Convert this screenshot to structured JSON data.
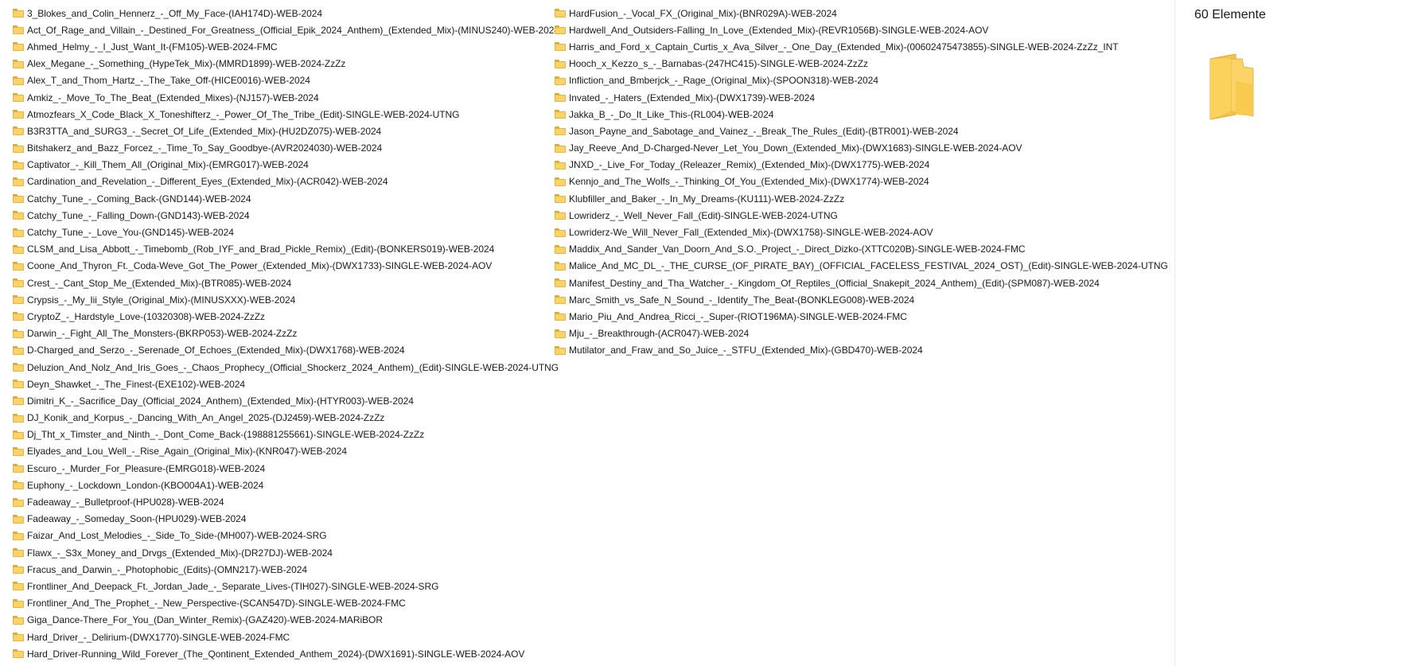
{
  "file_list": {
    "column_1": [
      "3_Blokes_and_Colin_Hennerz_-_Off_My_Face-(IAH174D)-WEB-2024",
      "Act_Of_Rage_and_Villain_-_Destined_For_Greatness_(Official_Epik_2024_Anthem)_(Extended_Mix)-(MINUS240)-WEB-2024",
      "Ahmed_Helmy_-_I_Just_Want_It-(FM105)-WEB-2024-FMC",
      "Alex_Megane_-_Something_(HypeTek_Mix)-(MMRD1899)-WEB-2024-ZzZz",
      "Alex_T_and_Thom_Hartz_-_The_Take_Off-(HICE0016)-WEB-2024",
      "Amkiz_-_Move_To_The_Beat_(Extended_Mixes)-(NJ157)-WEB-2024",
      "Atmozfears_X_Code_Black_X_Toneshifterz_-_Power_Of_The_Tribe_(Edit)-SINGLE-WEB-2024-UTNG",
      "B3R3TTA_and_SURG3_-_Secret_Of_Life_(Extended_Mix)-(HU2DZ075)-WEB-2024",
      "Bitshakerz_and_Bazz_Forcez_-_Time_To_Say_Goodbye-(AVR2024030)-WEB-2024",
      "Captivator_-_Kill_Them_All_(Original_Mix)-(EMRG017)-WEB-2024",
      "Cardination_and_Revelation_-_Different_Eyes_(Extended_Mix)-(ACR042)-WEB-2024",
      "Catchy_Tune_-_Coming_Back-(GND144)-WEB-2024",
      "Catchy_Tune_-_Falling_Down-(GND143)-WEB-2024",
      "Catchy_Tune_-_Love_You-(GND145)-WEB-2024",
      "CLSM_and_Lisa_Abbott_-_Timebomb_(Rob_IYF_and_Brad_Pickle_Remix)_(Edit)-(BONKERS019)-WEB-2024",
      "Coone_And_Thyron_Ft._Coda-Weve_Got_The_Power_(Extended_Mix)-(DWX1733)-SINGLE-WEB-2024-AOV",
      "Crest_-_Cant_Stop_Me_(Extended_Mix)-(BTR085)-WEB-2024",
      "Crypsis_-_My_Iii_Style_(Original_Mix)-(MINUSXXX)-WEB-2024",
      "CryptoZ_-_Hardstyle_Love-(10320308)-WEB-2024-ZzZz",
      "Darwin_-_Fight_All_The_Monsters-(BKRP053)-WEB-2024-ZzZz",
      "D-Charged_and_Serzo_-_Serenade_Of_Echoes_(Extended_Mix)-(DWX1768)-WEB-2024",
      "Deluzion_And_Nolz_And_Iris_Goes_-_Chaos_Prophecy_(Official_Shockerz_2024_Anthem)_(Edit)-SINGLE-WEB-2024-UTNG",
      "Deyn_Shawket_-_The_Finest-(EXE102)-WEB-2024",
      "Dimitri_K_-_Sacrifice_Day_(Official_2024_Anthem)_(Extended_Mix)-(HTYR003)-WEB-2024",
      "DJ_Konik_and_Korpus_-_Dancing_With_An_Angel_2025-(DJ2459)-WEB-2024-ZzZz",
      "Dj_Tht_x_Timster_and_Ninth_-_Dont_Come_Back-(198881255661)-SINGLE-WEB-2024-ZzZz",
      "Elyades_and_Lou_Well_-_Rise_Again_(Original_Mix)-(KNR047)-WEB-2024",
      "Escuro_-_Murder_For_Pleasure-(EMRG018)-WEB-2024",
      "Euphony_-_Lockdown_London-(KBO004A1)-WEB-2024",
      "Fadeaway_-_Bulletproof-(HPU028)-WEB-2024",
      "Fadeaway_-_Someday_Soon-(HPU029)-WEB-2024",
      "Faizar_And_Lost_Melodies_-_Side_To_Side-(MH007)-WEB-2024-SRG",
      "Flawx_-_S3x_Money_and_Drvgs_(Extended_Mix)-(DR27DJ)-WEB-2024",
      "Fracus_and_Darwin_-_Photophobic_(Edits)-(OMN217)-WEB-2024",
      "Frontliner_And_Deepack_Ft._Jordan_Jade_-_Separate_Lives-(TIH027)-SINGLE-WEB-2024-SRG",
      "Frontliner_And_The_Prophet_-_New_Perspective-(SCAN547D)-SINGLE-WEB-2024-FMC",
      "Giga_Dance-There_For_You_(Dan_Winter_Remix)-(GAZ420)-WEB-2024-MARiBOR",
      "Hard_Driver_-_Delirium-(DWX1770)-SINGLE-WEB-2024-FMC",
      "Hard_Driver-Running_Wild_Forever_(The_Qontinent_Extended_Anthem_2024)-(DWX1691)-SINGLE-WEB-2024-AOV"
    ],
    "column_2": [
      "HardFusion_-_Vocal_FX_(Original_Mix)-(BNR029A)-WEB-2024",
      "Hardwell_And_Outsiders-Falling_In_Love_(Extended_Mix)-(REVR1056B)-SINGLE-WEB-2024-AOV",
      "Harris_and_Ford_x_Captain_Curtis_x_Ava_Silver_-_One_Day_(Extended_Mix)-(00602475473855)-SINGLE-WEB-2024-ZzZz_INT",
      "Hooch_x_Kezzo_s_-_Barnabas-(247HC415)-SINGLE-WEB-2024-ZzZz",
      "Infliction_and_Bmberjck_-_Rage_(Original_Mix)-(SPOON318)-WEB-2024",
      "Invated_-_Haters_(Extended_Mix)-(DWX1739)-WEB-2024",
      "Jakka_B_-_Do_It_Like_This-(RL004)-WEB-2024",
      "Jason_Payne_and_Sabotage_and_Vainez_-_Break_The_Rules_(Edit)-(BTR001)-WEB-2024",
      "Jay_Reeve_And_D-Charged-Never_Let_You_Down_(Extended_Mix)-(DWX1683)-SINGLE-WEB-2024-AOV",
      "JNXD_-_Live_For_Today_(Releazer_Remix)_(Extended_Mix)-(DWX1775)-WEB-2024",
      "Kennjo_and_The_Wolfs_-_Thinking_Of_You_(Extended_Mix)-(DWX1774)-WEB-2024",
      "Klubfiller_and_Baker_-_In_My_Dreams-(KU111)-WEB-2024-ZzZz",
      "Lowriderz_-_Well_Never_Fall_(Edit)-SINGLE-WEB-2024-UTNG",
      "Lowriderz-We_Will_Never_Fall_(Extended_Mix)-(DWX1758)-SINGLE-WEB-2024-AOV",
      "Maddix_And_Sander_Van_Doorn_And_S.O._Project_-_Direct_Dizko-(XTTC020B)-SINGLE-WEB-2024-FMC",
      "Malice_And_MC_DL_-_THE_CURSE_(OF_PIRATE_BAY)_(OFFICIAL_FACELESS_FESTIVAL_2024_OST)_(Edit)-SINGLE-WEB-2024-UTNG",
      "Manifest_Destiny_and_Tha_Watcher_-_Kingdom_Of_Reptiles_(Official_Snakepit_2024_Anthem)_(Edit)-(SPM087)-WEB-2024",
      "Marc_Smith_vs_Safe_N_Sound_-_Identify_The_Beat-(BONKLEG008)-WEB-2024",
      "Mario_Piu_And_Andrea_Ricci_-_Super-(RIOT196MA)-SINGLE-WEB-2024-FMC",
      "Mju_-_Breakthrough-(ACR047)-WEB-2024",
      "Mutilator_and_Fraw_and_So_Juice_-_STFU_(Extended_Mix)-(GBD470)-WEB-2024"
    ]
  },
  "details_pane": {
    "item_count": "60 Elemente",
    "preview_icon": "folder-icon"
  },
  "colors": {
    "folder_fill": "#fcd367",
    "folder_tab": "#e0a92b",
    "background": "#ffffff",
    "text": "#1a1a1a"
  }
}
